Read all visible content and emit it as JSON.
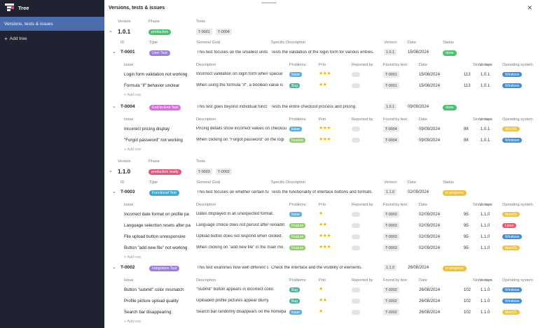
{
  "sidebar": {
    "title": "Tree",
    "active_item": "Versions, tests & issues",
    "add_label": "Add tree"
  },
  "main": {
    "title": "Versions, tests & issues",
    "close_icon": "close-icon"
  },
  "version_headers": {
    "version": "Version",
    "phase": "Phase",
    "tests": "Tests"
  },
  "test_headers": {
    "id": "ID",
    "type": "Type",
    "goal": "General Goal",
    "desc": "Specific Description",
    "version": "Version",
    "date": "Date",
    "status": "Status"
  },
  "issue_headers": {
    "issue": "Issue",
    "description": "Description",
    "problems": "Problems",
    "prio": "Prio",
    "reported_by": "Reported by",
    "found_by_test": "Found by test",
    "date": "Date",
    "since_days": "Since days",
    "version": "Version",
    "os": "Operating system"
  },
  "add_row_label": "+ Add row",
  "colors": {
    "sidebar_bg": "#1f2230",
    "active_bg": "#4b6dad",
    "star": "#f2b600"
  },
  "versions": [
    {
      "name": "1.0.1",
      "phase": "production",
      "phase_color": "#49c46b",
      "tests": [
        "T-0001",
        "T-0004"
      ],
      "test_cases": [
        {
          "id": "T-0001",
          "type": "User Test",
          "type_color": "#9c7de0",
          "goal": "This test focuses on the smallest units",
          "desc": "Tests the validation of the login form for various entries.",
          "version": "1.0.1",
          "date": "15/08/2024",
          "status": "done",
          "status_color": "#49c46b",
          "issues": [
            {
              "issue": "Login form validation not working",
              "description": "Incorrect validation on login form when special",
              "problem": "Issue",
              "problem_color": "#5ab0e6",
              "prio": "★★★",
              "test": "T-0001",
              "date": "15/08/2024",
              "since": "113",
              "version": "1.0.1",
              "os": "Windows",
              "os_color": "#3d8fe0"
            },
            {
              "issue": "Formula \"if\" behavior unclear",
              "description": "When using the formula \"if\", a boolean value is",
              "problem": "Bug",
              "problem_color": "#3fb6a8",
              "prio": "★★",
              "test": "T-0001",
              "date": "15/08/2024",
              "since": "113",
              "version": "1.0.1",
              "os": "Windows",
              "os_color": "#3d8fe0"
            }
          ]
        },
        {
          "id": "T-0004",
          "type": "End-to-End Test",
          "type_color": "#d86de0",
          "goal": "This test goes beyond individual funct",
          "desc": "Tests the entire checkout process and pricing.",
          "version": "1.0.1",
          "date": "09/09/2024",
          "status": "done",
          "status_color": "#49c46b",
          "issues": [
            {
              "issue": "Incorrect pricing display",
              "description": "Pricing details show incorrect values on checkou",
              "problem": "Issue",
              "problem_color": "#5ab0e6",
              "prio": "★★★",
              "test": "T-0004",
              "date": "09/09/2024",
              "since": "88",
              "version": "1.0.1",
              "os": "MacOS",
              "os_color": "#f0c23a"
            },
            {
              "issue": "\"Forgot password\" not working",
              "description": "When clicking on \"Forgot password\" on the logi",
              "problem": "Feature",
              "problem_color": "#8fcf6a",
              "prio": "★★★",
              "test": "T-0004",
              "date": "09/09/2024",
              "since": "88",
              "version": "1.0.1",
              "os": "Windows",
              "os_color": "#3d8fe0"
            }
          ]
        }
      ]
    },
    {
      "name": "1.1.0",
      "phase": "production ready",
      "phase_color": "#e8557a",
      "tests": [
        "T-0003",
        "T-0002"
      ],
      "test_cases": [
        {
          "id": "T-0003",
          "type": "Functional Test",
          "type_color": "#3aa9d6",
          "goal": "This test focuses on whether certain fu",
          "desc": "Tests the functionality of interface buttons and formats.",
          "version": "1.1.0",
          "date": "02/09/2024",
          "status": "in progress",
          "status_color": "#f2c037",
          "issues": [
            {
              "issue": "Incorrect date format on profile pa",
              "description": "Dates displayed in an unexpected format.",
              "problem": "Issue",
              "problem_color": "#5ab0e6",
              "prio": "★",
              "test": "T-0003",
              "date": "02/09/2024",
              "since": "95",
              "version": "1.1.0",
              "os": "MacOS",
              "os_color": "#f0c23a"
            },
            {
              "issue": "Language selection resets after pa",
              "description": "Language choice does not persist after reloadin",
              "problem": "Feature",
              "problem_color": "#8fcf6a",
              "prio": "★★",
              "test": "T-0003",
              "date": "02/09/2024",
              "since": "95",
              "version": "1.1.0",
              "os": "Linux",
              "os_color": "#e85a6a"
            },
            {
              "issue": "File upload button unresponsive",
              "description": "Upload button does not respond when clicked.",
              "problem": "Feature",
              "problem_color": "#8fcf6a",
              "prio": "★★★",
              "test": "T-0003",
              "date": "02/09/2024",
              "since": "95",
              "version": "1.1.0",
              "os": "Windows",
              "os_color": "#3d8fe0"
            },
            {
              "issue": "Button \"add new file\" not working",
              "description": "When clicking on \"add new file\" in the main mo",
              "problem": "Feature",
              "problem_color": "#8fcf6a",
              "prio": "★★★",
              "test": "T-0003",
              "date": "02/09/2024",
              "since": "95",
              "version": "1.1.0",
              "os": "MacOS",
              "os_color": "#f0c23a"
            }
          ]
        },
        {
          "id": "T-0002",
          "type": "Integration Test",
          "type_color": "#9c7de0",
          "goal": "This test examines how well different c",
          "desc": "Check the interface and the visibility of elements.",
          "version": "1.1.0",
          "date": "26/08/2024",
          "status": "in progress",
          "status_color": "#f2c037",
          "issues": [
            {
              "issue": "Button \"submit\" color mismatch",
              "description": "\"Submit\" button appears in incorrect color.",
              "problem": "Bug",
              "problem_color": "#3fb6a8",
              "prio": "★",
              "test": "T-0002",
              "date": "26/08/2024",
              "since": "102",
              "version": "1.1.0",
              "os": "Windows",
              "os_color": "#3d8fe0"
            },
            {
              "issue": "Profile picture upload quality",
              "description": "Uploaded profile pictures appear blurry.",
              "problem": "Bug",
              "problem_color": "#3fb6a8",
              "prio": "★★",
              "test": "T-0002",
              "date": "26/08/2024",
              "since": "102",
              "version": "1.1.0",
              "os": "Windows",
              "os_color": "#3d8fe0"
            },
            {
              "issue": "Search bar disappearing",
              "description": "Search bar randomly disappears on the homepa",
              "problem": "Issue",
              "problem_color": "#5ab0e6",
              "prio": "★",
              "test": "T-0002",
              "date": "26/08/2024",
              "since": "102",
              "version": "1.1.0",
              "os": "MacOS",
              "os_color": "#f0c23a"
            }
          ]
        }
      ]
    }
  ]
}
